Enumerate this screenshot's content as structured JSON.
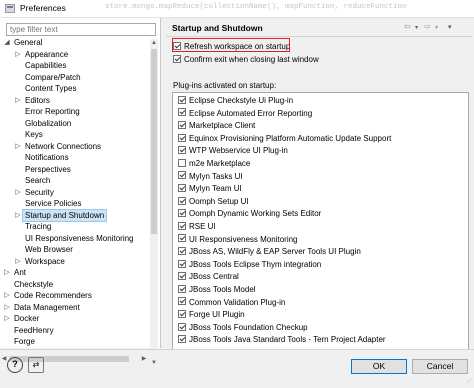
{
  "window": {
    "title": "Preferences",
    "background_text": "store.mongo.mapReduce(collectionName(), mapFunction, reduceFunction"
  },
  "left": {
    "filter_placeholder": "type filter text",
    "tree": [
      {
        "label": "General",
        "indent": 0,
        "twisty": "open"
      },
      {
        "label": "Appearance",
        "indent": 1,
        "twisty": "closed"
      },
      {
        "label": "Capabilities",
        "indent": 1,
        "twisty": ""
      },
      {
        "label": "Compare/Patch",
        "indent": 1,
        "twisty": ""
      },
      {
        "label": "Content Types",
        "indent": 1,
        "twisty": ""
      },
      {
        "label": "Editors",
        "indent": 1,
        "twisty": "closed"
      },
      {
        "label": "Error Reporting",
        "indent": 1,
        "twisty": ""
      },
      {
        "label": "Globalization",
        "indent": 1,
        "twisty": ""
      },
      {
        "label": "Keys",
        "indent": 1,
        "twisty": ""
      },
      {
        "label": "Network Connections",
        "indent": 1,
        "twisty": "closed"
      },
      {
        "label": "Notifications",
        "indent": 1,
        "twisty": ""
      },
      {
        "label": "Perspectives",
        "indent": 1,
        "twisty": ""
      },
      {
        "label": "Search",
        "indent": 1,
        "twisty": ""
      },
      {
        "label": "Security",
        "indent": 1,
        "twisty": "closed"
      },
      {
        "label": "Service Policies",
        "indent": 1,
        "twisty": ""
      },
      {
        "label": "Startup and Shutdown",
        "indent": 1,
        "twisty": "closed",
        "selected": true
      },
      {
        "label": "Tracing",
        "indent": 1,
        "twisty": ""
      },
      {
        "label": "UI Responsiveness Monitoring",
        "indent": 1,
        "twisty": ""
      },
      {
        "label": "Web Browser",
        "indent": 1,
        "twisty": ""
      },
      {
        "label": "Workspace",
        "indent": 1,
        "twisty": "closed"
      },
      {
        "label": "Ant",
        "indent": 0,
        "twisty": "closed"
      },
      {
        "label": "Checkstyle",
        "indent": 0,
        "twisty": ""
      },
      {
        "label": "Code Recommenders",
        "indent": 0,
        "twisty": "closed"
      },
      {
        "label": "Data Management",
        "indent": 0,
        "twisty": "closed"
      },
      {
        "label": "Docker",
        "indent": 0,
        "twisty": "closed"
      },
      {
        "label": "FeedHenry",
        "indent": 0,
        "twisty": ""
      },
      {
        "label": "Forge",
        "indent": 0,
        "twisty": ""
      }
    ]
  },
  "right": {
    "title": "Startup and Shutdown",
    "refresh_label": "Refresh workspace on startup",
    "refresh_checked": true,
    "confirm_label": "Confirm exit when closing last window",
    "confirm_checked": true,
    "plugins_label": "Plug-ins activated on startup:",
    "plugins": [
      {
        "label": "Eclipse Checkstyle Ui Plug-in",
        "checked": true
      },
      {
        "label": "Eclipse Automated Error Reporting",
        "checked": true
      },
      {
        "label": "Marketplace Client",
        "checked": true
      },
      {
        "label": "Equinox Provisioning Platform Automatic Update Support",
        "checked": true
      },
      {
        "label": "WTP Webservice UI Plug-in",
        "checked": true
      },
      {
        "label": "m2e Marketplace",
        "checked": false
      },
      {
        "label": "Mylyn Tasks UI",
        "checked": true
      },
      {
        "label": "Mylyn Team UI",
        "checked": true
      },
      {
        "label": "Oomph Setup UI",
        "checked": true
      },
      {
        "label": "Oomph Dynamic Working Sets Editor",
        "checked": true
      },
      {
        "label": "RSE UI",
        "checked": true
      },
      {
        "label": "UI Responsiveness Monitoring",
        "checked": true
      },
      {
        "label": "JBoss AS, WildFly & EAP Server Tools UI Plugin",
        "checked": true
      },
      {
        "label": "JBoss Tools Eclipse Thym integration",
        "checked": true
      },
      {
        "label": "JBoss Central",
        "checked": true
      },
      {
        "label": "JBoss Tools Model",
        "checked": true
      },
      {
        "label": "Common Validation Plug-in",
        "checked": true
      },
      {
        "label": "Forge UI Plugin",
        "checked": true
      },
      {
        "label": "JBoss Tools Foundation Checkup",
        "checked": true
      },
      {
        "label": "JBoss Tools Java Standard Tools - Tern Project Adapter",
        "checked": true
      }
    ]
  },
  "buttons": {
    "ok": "OK",
    "cancel": "Cancel"
  },
  "colors": {
    "highlight_border": "#e02020",
    "selection": "#cce4f7",
    "default_button_border": "#0078d7"
  }
}
